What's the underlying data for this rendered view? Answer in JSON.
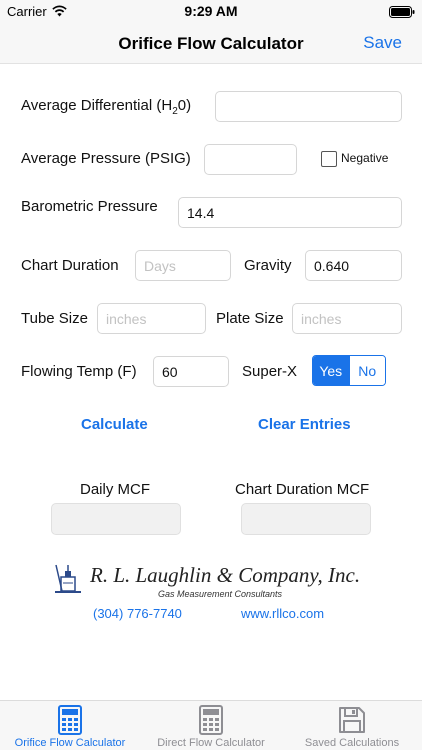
{
  "status_bar": {
    "carrier": "Carrier",
    "time": "9:29 AM"
  },
  "nav": {
    "title": "Orifice Flow Calculator",
    "save_label": "Save"
  },
  "form": {
    "avg_differential_label_pre": "Average Differential (H",
    "avg_differential_label_sub": "2",
    "avg_differential_label_post": "0)",
    "avg_differential_value": "",
    "avg_pressure_label": "Average Pressure (PSIG)",
    "avg_pressure_value": "",
    "negative_label": "Negative",
    "barometric_label": "Barometric Pressure",
    "barometric_value": "14.4",
    "chart_duration_label": "Chart Duration",
    "chart_duration_placeholder": "Days",
    "gravity_label": "Gravity",
    "gravity_value": "0.640",
    "tube_size_label": "Tube Size",
    "tube_size_placeholder": "inches",
    "plate_size_label": "Plate Size",
    "plate_size_placeholder": "inches",
    "flowing_temp_label": "Flowing Temp (F)",
    "flowing_temp_value": "60",
    "superx_label": "Super-X",
    "superx_yes": "Yes",
    "superx_no": "No",
    "superx_selected": "Yes"
  },
  "actions": {
    "calculate": "Calculate",
    "clear": "Clear Entries"
  },
  "results": {
    "daily_mcf_label": "Daily MCF",
    "chart_duration_mcf_label": "Chart Duration MCF"
  },
  "company": {
    "name": "R. L. Laughlin & Company, Inc.",
    "tagline": "Gas Measurement Consultants",
    "phone": "(304) 776-7740",
    "website": "www.rllco.com"
  },
  "tabs": [
    {
      "label": "Orifice Flow Calculator",
      "icon": "calculator-icon",
      "active": true
    },
    {
      "label": "Direct Flow Calculator",
      "icon": "calculator-icon",
      "active": false
    },
    {
      "label": "Saved Calculations",
      "icon": "floppy-disk-icon",
      "active": false
    }
  ],
  "colors": {
    "accent": "#1a73e8",
    "inactive_tab": "#8e8e93"
  }
}
